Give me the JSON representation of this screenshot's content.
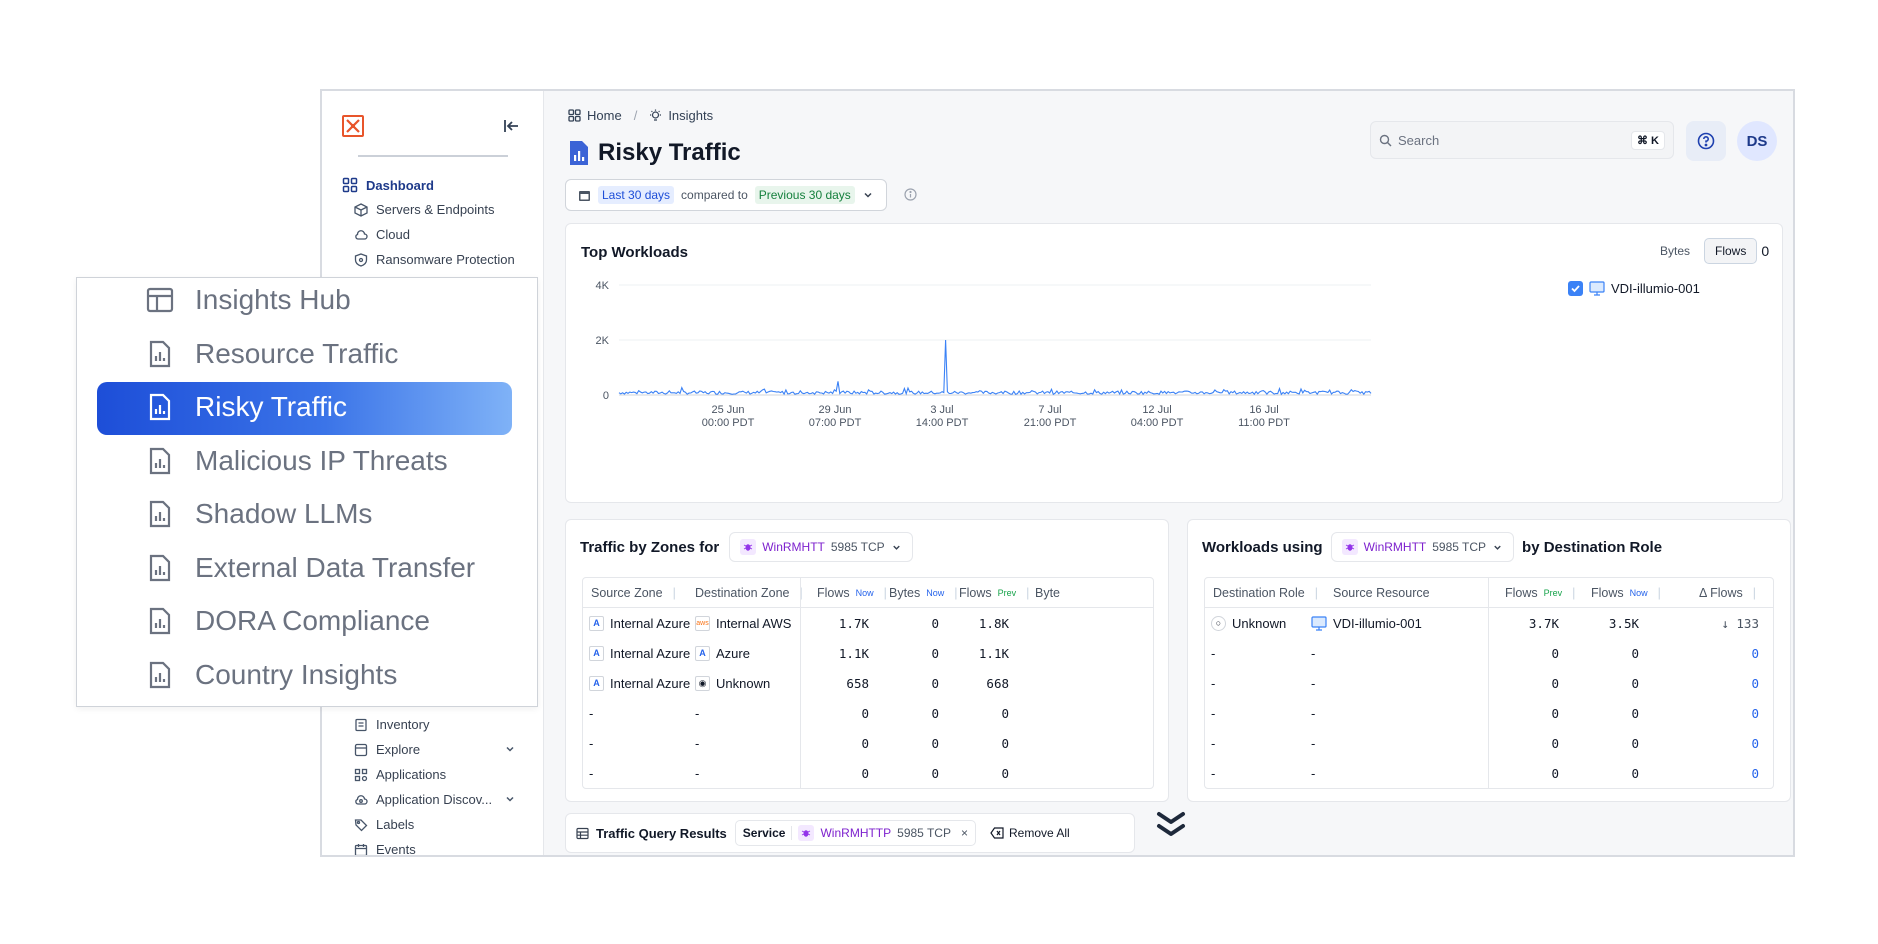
{
  "sidebar": {
    "dashboard": "Dashboard",
    "sub_items": [
      "Servers & Endpoints",
      "Cloud",
      "Ransomware Protection"
    ],
    "lower_items": [
      "Inventory",
      "Explore",
      "Applications",
      "Application Discov...",
      "Labels",
      "Events"
    ]
  },
  "callout": {
    "items": [
      "Insights Hub",
      "Resource Traffic",
      "Risky Traffic",
      "Malicious IP Threats",
      "Shadow LLMs",
      "External Data Transfer",
      "DORA Compliance",
      "Country Insights"
    ]
  },
  "header": {
    "breadcrumb_home": "Home",
    "breadcrumb_insights": "Insights",
    "title": "Risky Traffic",
    "search_placeholder": "Search",
    "search_shortcut": "⌘ K",
    "avatar": "DS"
  },
  "date_filter": {
    "range": "Last 30 days",
    "compared_to": "compared to",
    "previous": "Previous 30 days"
  },
  "top_workloads": {
    "title": "Top Workloads",
    "toggle_bytes": "Bytes",
    "toggle_flows": "Flows",
    "counter": "0",
    "legend_item": "VDI-illumio-001"
  },
  "chart_data": {
    "type": "line",
    "series": [
      {
        "name": "VDI-illumio-001",
        "color": "#3b82f6"
      }
    ],
    "y_ticks": [
      "0",
      "2K",
      "4K"
    ],
    "ylim": [
      0,
      4000
    ],
    "x_ticks": [
      {
        "date": "25 Jun",
        "time": "00:00 PDT"
      },
      {
        "date": "29 Jun",
        "time": "07:00 PDT"
      },
      {
        "date": "3 Jul",
        "time": "14:00 PDT"
      },
      {
        "date": "7 Jul",
        "time": "21:00 PDT"
      },
      {
        "date": "12 Jul",
        "time": "04:00 PDT"
      },
      {
        "date": "16 Jul",
        "time": "11:00 PDT"
      }
    ],
    "baseline": 80,
    "noise": 120,
    "spikes": [
      {
        "at": "3 Jul",
        "value": 2000
      },
      {
        "at": "29 Jun",
        "value": 500
      }
    ]
  },
  "zones_table": {
    "title": "Traffic by Zones for",
    "service": "WinRMHTT",
    "port": "5985 TCP",
    "headers": [
      "Source Zone",
      "Destination Zone",
      "Flows",
      "Bytes",
      "Flows",
      "Byte"
    ],
    "header_tags": [
      "Now",
      "Now",
      "Prev"
    ],
    "rows": [
      [
        "Internal Azure",
        "Internal AWS",
        "1.7K",
        "0",
        "1.8K"
      ],
      [
        "Internal Azure",
        "Azure",
        "1.1K",
        "0",
        "1.1K"
      ],
      [
        "Internal Azure",
        "Unknown",
        "658",
        "0",
        "668"
      ],
      [
        "-",
        "-",
        "0",
        "0",
        "0"
      ],
      [
        "-",
        "-",
        "0",
        "0",
        "0"
      ],
      [
        "-",
        "-",
        "0",
        "0",
        "0"
      ]
    ]
  },
  "workloads_table": {
    "title": "Workloads using",
    "title_suffix": "by Destination Role",
    "service": "WinRMHTT",
    "port": "5985 TCP",
    "headers": [
      "Destination Role",
      "Source Resource",
      "Flows",
      "Flows",
      "Δ Flows"
    ],
    "header_tags": [
      "Prev",
      "Now"
    ],
    "rows": [
      [
        "Unknown",
        "VDI-illumio-001",
        "3.7K",
        "3.5K",
        "↓ 133"
      ],
      [
        "-",
        "-",
        "0",
        "0",
        "0"
      ],
      [
        "-",
        "-",
        "0",
        "0",
        "0"
      ],
      [
        "-",
        "-",
        "0",
        "0",
        "0"
      ],
      [
        "-",
        "-",
        "0",
        "0",
        "0"
      ],
      [
        "-",
        "-",
        "0",
        "0",
        "0"
      ]
    ]
  },
  "query_bar": {
    "title": "Traffic Query Results",
    "chip_label": "Service",
    "chip_service": "WinRMHTTP",
    "chip_port": "5985 TCP",
    "chip_remove": "×",
    "remove_all": "Remove All"
  }
}
